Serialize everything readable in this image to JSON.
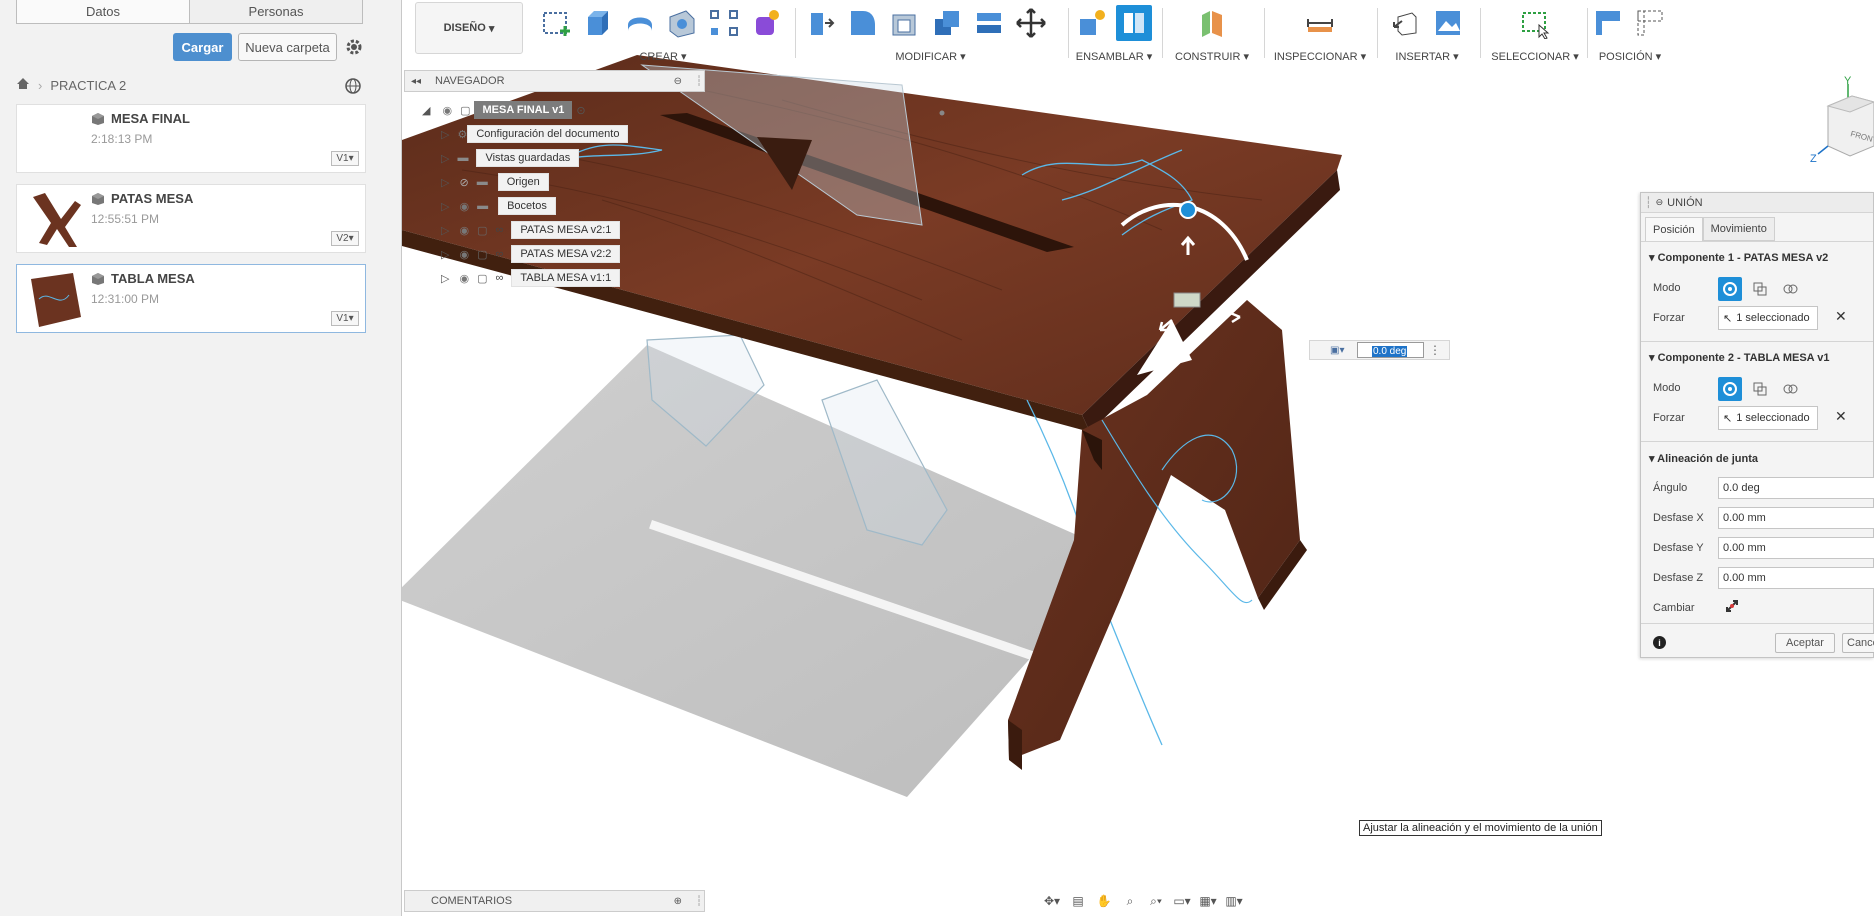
{
  "data_panel": {
    "tabs": [
      "Datos",
      "Personas"
    ],
    "upload_label": "Cargar",
    "new_folder_label": "Nueva carpeta",
    "breadcrumb": "PRACTICA 2",
    "files": [
      {
        "name": "MESA FINAL",
        "time": "2:18:13 PM",
        "version": "V1"
      },
      {
        "name": "PATAS MESA",
        "time": "12:55:51 PM",
        "version": "V2"
      },
      {
        "name": "TABLA MESA",
        "time": "12:31:00 PM",
        "version": "V1"
      }
    ]
  },
  "toolbar": {
    "workspace": "DISEÑO",
    "groups": {
      "crear": "CREAR",
      "modificar": "MODIFICAR",
      "ensamblar": "ENSAMBLAR",
      "construir": "CONSTRUIR",
      "inspeccionar": "INSPECCIONAR",
      "insertar": "INSERTAR",
      "seleccionar": "SELECCIONAR",
      "posicion": "POSICIÓN"
    }
  },
  "browser": {
    "title": "NAVEGADOR",
    "root": "MESA FINAL v1",
    "items": [
      "Configuración del documento",
      "Vistas guardadas",
      "Origen",
      "Bocetos",
      "PATAS MESA v2:1",
      "PATAS MESA v2:2",
      "TABLA MESA v1:1"
    ]
  },
  "comments_label": "COMENTARIOS",
  "joint_dialog": {
    "title": "UNIÓN",
    "tabs": [
      "Posición",
      "Movimiento"
    ],
    "component1": "Componente 1 - PATAS MESA v2",
    "component2": "Componente 2 - TABLA MESA v1",
    "mode_label": "Modo",
    "snap_label": "Forzar",
    "selected_text": "1 seleccionado",
    "alignment_section": "Alineación de junta",
    "angle_label": "Ángulo",
    "angle_value": "0.0 deg",
    "offset_x_label": "Desfase X",
    "offset_x_value": "0.00 mm",
    "offset_y_label": "Desfase Y",
    "offset_y_value": "0.00 mm",
    "offset_z_label": "Desfase Z",
    "offset_z_value": "0.00 mm",
    "flip_label": "Cambiar",
    "ok_label": "Aceptar",
    "cancel_label": "Cancelar"
  },
  "angle_input_value": "0.0 deg",
  "tooltip": "Ajustar la alineación y el movimiento de la unión",
  "viewcube": {
    "front_label": "FRONTAL",
    "y": "Y",
    "z": "Z"
  },
  "colors": {
    "accent": "#1e8fd8",
    "wood": "#6e3422",
    "edge": "#5bb8e8"
  }
}
